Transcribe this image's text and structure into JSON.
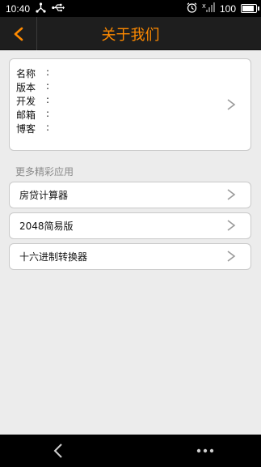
{
  "status": {
    "time": "10:40",
    "battery_text": "100",
    "battery_level": 1.0,
    "signal_text": "X"
  },
  "header": {
    "title": "关于我们",
    "back_icon": "chevron-left-icon",
    "accent_color": "#ff8a00"
  },
  "about": {
    "fields": [
      {
        "label": "名称",
        "colon": ":"
      },
      {
        "label": "版本",
        "colon": ":"
      },
      {
        "label": "开发",
        "colon": ":"
      },
      {
        "label": "邮箱",
        "colon": ":"
      },
      {
        "label": "博客",
        "colon": ":"
      }
    ]
  },
  "more_apps": {
    "section_label": "更多精彩应用",
    "items": [
      {
        "label": "房贷计算器"
      },
      {
        "label": "2048简易版"
      },
      {
        "label": "十六进制转换器"
      }
    ]
  },
  "navbar": {
    "back_icon": "nav-back-icon",
    "menu_icon": "more-dots-icon"
  }
}
